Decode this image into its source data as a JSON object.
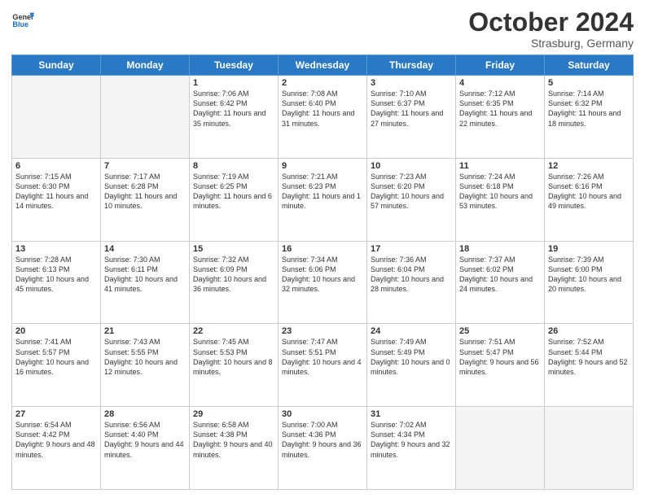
{
  "header": {
    "logo_general": "General",
    "logo_blue": "Blue",
    "month": "October 2024",
    "location": "Strasburg, Germany"
  },
  "days_of_week": [
    "Sunday",
    "Monday",
    "Tuesday",
    "Wednesday",
    "Thursday",
    "Friday",
    "Saturday"
  ],
  "weeks": [
    [
      {
        "day": "",
        "empty": true
      },
      {
        "day": "",
        "empty": true
      },
      {
        "day": "1",
        "sunrise": "Sunrise: 7:06 AM",
        "sunset": "Sunset: 6:42 PM",
        "daylight": "Daylight: 11 hours and 35 minutes."
      },
      {
        "day": "2",
        "sunrise": "Sunrise: 7:08 AM",
        "sunset": "Sunset: 6:40 PM",
        "daylight": "Daylight: 11 hours and 31 minutes."
      },
      {
        "day": "3",
        "sunrise": "Sunrise: 7:10 AM",
        "sunset": "Sunset: 6:37 PM",
        "daylight": "Daylight: 11 hours and 27 minutes."
      },
      {
        "day": "4",
        "sunrise": "Sunrise: 7:12 AM",
        "sunset": "Sunset: 6:35 PM",
        "daylight": "Daylight: 11 hours and 22 minutes."
      },
      {
        "day": "5",
        "sunrise": "Sunrise: 7:14 AM",
        "sunset": "Sunset: 6:32 PM",
        "daylight": "Daylight: 11 hours and 18 minutes."
      }
    ],
    [
      {
        "day": "6",
        "sunrise": "Sunrise: 7:15 AM",
        "sunset": "Sunset: 6:30 PM",
        "daylight": "Daylight: 11 hours and 14 minutes."
      },
      {
        "day": "7",
        "sunrise": "Sunrise: 7:17 AM",
        "sunset": "Sunset: 6:28 PM",
        "daylight": "Daylight: 11 hours and 10 minutes."
      },
      {
        "day": "8",
        "sunrise": "Sunrise: 7:19 AM",
        "sunset": "Sunset: 6:25 PM",
        "daylight": "Daylight: 11 hours and 6 minutes."
      },
      {
        "day": "9",
        "sunrise": "Sunrise: 7:21 AM",
        "sunset": "Sunset: 6:23 PM",
        "daylight": "Daylight: 11 hours and 1 minute."
      },
      {
        "day": "10",
        "sunrise": "Sunrise: 7:23 AM",
        "sunset": "Sunset: 6:20 PM",
        "daylight": "Daylight: 10 hours and 57 minutes."
      },
      {
        "day": "11",
        "sunrise": "Sunrise: 7:24 AM",
        "sunset": "Sunset: 6:18 PM",
        "daylight": "Daylight: 10 hours and 53 minutes."
      },
      {
        "day": "12",
        "sunrise": "Sunrise: 7:26 AM",
        "sunset": "Sunset: 6:16 PM",
        "daylight": "Daylight: 10 hours and 49 minutes."
      }
    ],
    [
      {
        "day": "13",
        "sunrise": "Sunrise: 7:28 AM",
        "sunset": "Sunset: 6:13 PM",
        "daylight": "Daylight: 10 hours and 45 minutes."
      },
      {
        "day": "14",
        "sunrise": "Sunrise: 7:30 AM",
        "sunset": "Sunset: 6:11 PM",
        "daylight": "Daylight: 10 hours and 41 minutes."
      },
      {
        "day": "15",
        "sunrise": "Sunrise: 7:32 AM",
        "sunset": "Sunset: 6:09 PM",
        "daylight": "Daylight: 10 hours and 36 minutes."
      },
      {
        "day": "16",
        "sunrise": "Sunrise: 7:34 AM",
        "sunset": "Sunset: 6:06 PM",
        "daylight": "Daylight: 10 hours and 32 minutes."
      },
      {
        "day": "17",
        "sunrise": "Sunrise: 7:36 AM",
        "sunset": "Sunset: 6:04 PM",
        "daylight": "Daylight: 10 hours and 28 minutes."
      },
      {
        "day": "18",
        "sunrise": "Sunrise: 7:37 AM",
        "sunset": "Sunset: 6:02 PM",
        "daylight": "Daylight: 10 hours and 24 minutes."
      },
      {
        "day": "19",
        "sunrise": "Sunrise: 7:39 AM",
        "sunset": "Sunset: 6:00 PM",
        "daylight": "Daylight: 10 hours and 20 minutes."
      }
    ],
    [
      {
        "day": "20",
        "sunrise": "Sunrise: 7:41 AM",
        "sunset": "Sunset: 5:57 PM",
        "daylight": "Daylight: 10 hours and 16 minutes."
      },
      {
        "day": "21",
        "sunrise": "Sunrise: 7:43 AM",
        "sunset": "Sunset: 5:55 PM",
        "daylight": "Daylight: 10 hours and 12 minutes."
      },
      {
        "day": "22",
        "sunrise": "Sunrise: 7:45 AM",
        "sunset": "Sunset: 5:53 PM",
        "daylight": "Daylight: 10 hours and 8 minutes."
      },
      {
        "day": "23",
        "sunrise": "Sunrise: 7:47 AM",
        "sunset": "Sunset: 5:51 PM",
        "daylight": "Daylight: 10 hours and 4 minutes."
      },
      {
        "day": "24",
        "sunrise": "Sunrise: 7:49 AM",
        "sunset": "Sunset: 5:49 PM",
        "daylight": "Daylight: 10 hours and 0 minutes."
      },
      {
        "day": "25",
        "sunrise": "Sunrise: 7:51 AM",
        "sunset": "Sunset: 5:47 PM",
        "daylight": "Daylight: 9 hours and 56 minutes."
      },
      {
        "day": "26",
        "sunrise": "Sunrise: 7:52 AM",
        "sunset": "Sunset: 5:44 PM",
        "daylight": "Daylight: 9 hours and 52 minutes."
      }
    ],
    [
      {
        "day": "27",
        "sunrise": "Sunrise: 6:54 AM",
        "sunset": "Sunset: 4:42 PM",
        "daylight": "Daylight: 9 hours and 48 minutes."
      },
      {
        "day": "28",
        "sunrise": "Sunrise: 6:56 AM",
        "sunset": "Sunset: 4:40 PM",
        "daylight": "Daylight: 9 hours and 44 minutes."
      },
      {
        "day": "29",
        "sunrise": "Sunrise: 6:58 AM",
        "sunset": "Sunset: 4:38 PM",
        "daylight": "Daylight: 9 hours and 40 minutes."
      },
      {
        "day": "30",
        "sunrise": "Sunrise: 7:00 AM",
        "sunset": "Sunset: 4:36 PM",
        "daylight": "Daylight: 9 hours and 36 minutes."
      },
      {
        "day": "31",
        "sunrise": "Sunrise: 7:02 AM",
        "sunset": "Sunset: 4:34 PM",
        "daylight": "Daylight: 9 hours and 32 minutes."
      },
      {
        "day": "",
        "empty": true
      },
      {
        "day": "",
        "empty": true
      }
    ]
  ]
}
